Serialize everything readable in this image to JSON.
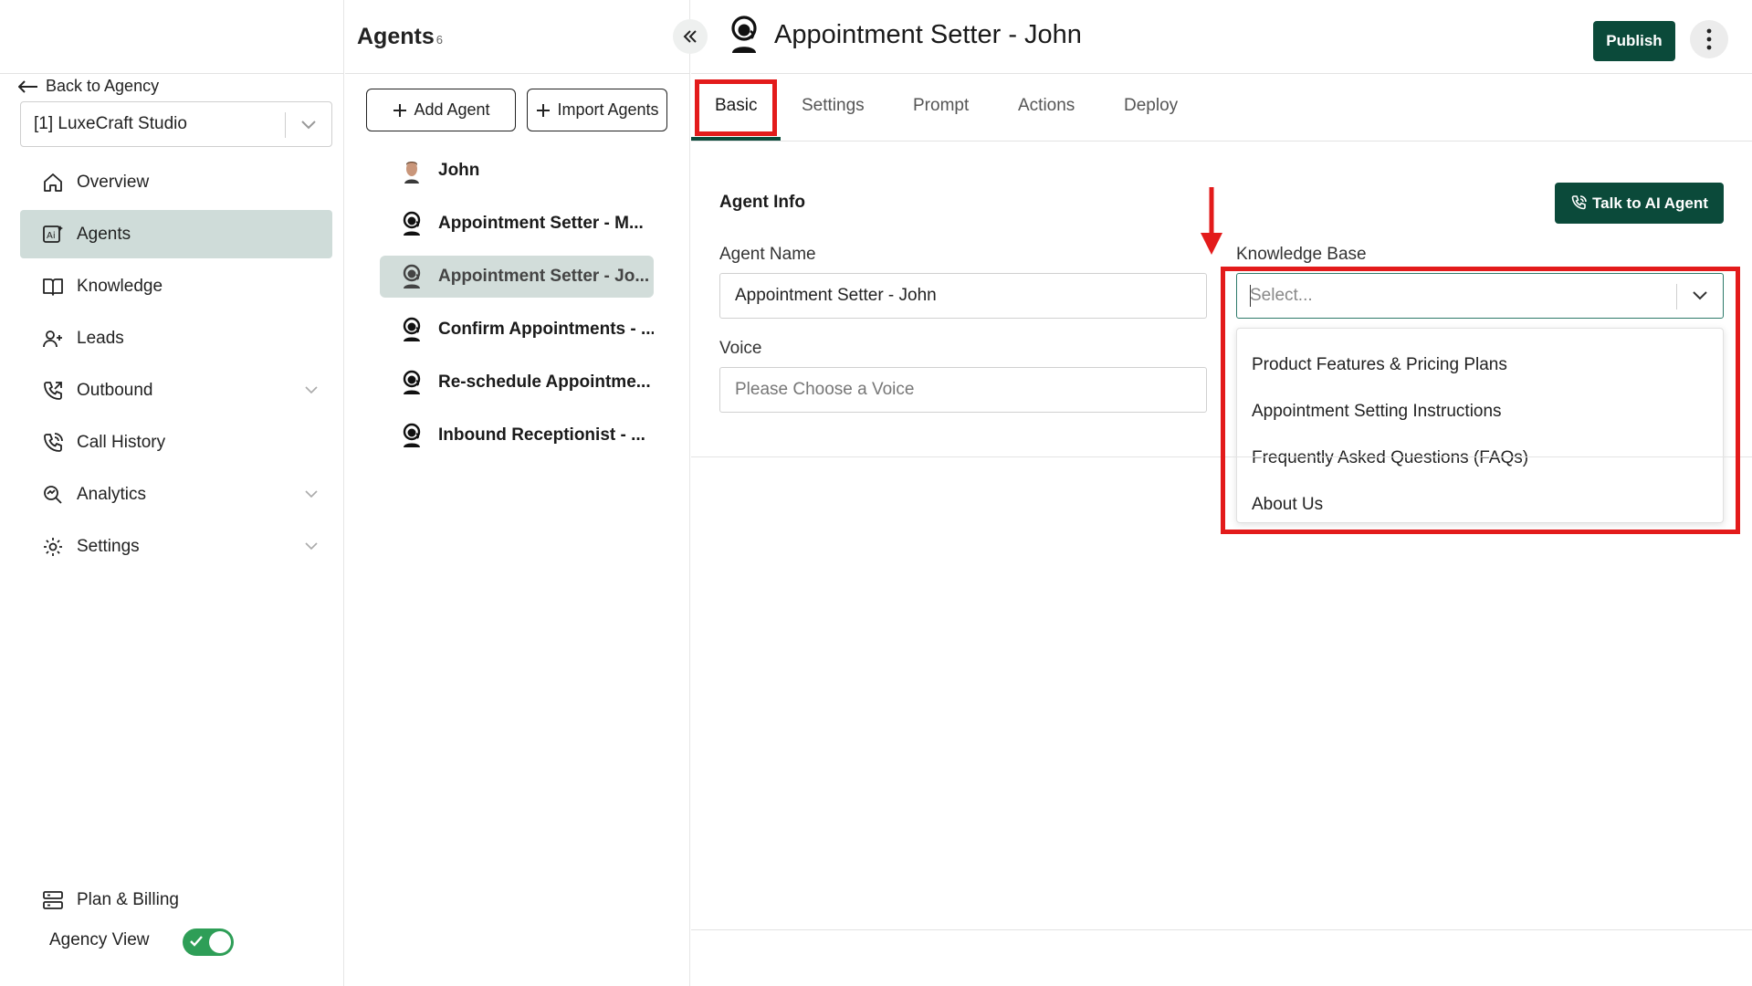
{
  "sidebar": {
    "back_label": "Back to Agency",
    "agency_select": "[1] LuxeCraft Studio",
    "items": [
      {
        "label": "Overview",
        "icon": "home-icon"
      },
      {
        "label": "Agents",
        "icon": "ai-agent-icon",
        "active": true
      },
      {
        "label": "Knowledge",
        "icon": "book-icon"
      },
      {
        "label": "Leads",
        "icon": "user-plus-icon"
      },
      {
        "label": "Outbound",
        "icon": "phone-outgoing-icon",
        "expandable": true
      },
      {
        "label": "Call History",
        "icon": "phone-history-icon"
      },
      {
        "label": "Analytics",
        "icon": "analytics-icon",
        "expandable": true
      },
      {
        "label": "Settings",
        "icon": "gear-icon",
        "expandable": true
      }
    ],
    "billing_label": "Plan & Billing",
    "agency_view_label": "Agency View",
    "agency_view_on": true
  },
  "agents": {
    "title": "Agents",
    "count": "6",
    "add_label": "Add Agent",
    "import_label": "Import Agents",
    "list": [
      {
        "name": "John",
        "icon": "avatar-photo"
      },
      {
        "name": "Appointment Setter - M...",
        "icon": "agent-headset-icon"
      },
      {
        "name": "Appointment Setter - Jo...",
        "icon": "agent-headset-icon",
        "active": true
      },
      {
        "name": "Confirm Appointments - ...",
        "icon": "agent-headset-icon"
      },
      {
        "name": "Re-schedule Appointme...",
        "icon": "agent-headset-icon"
      },
      {
        "name": "Inbound Receptionist - ...",
        "icon": "agent-headset-icon"
      }
    ]
  },
  "header": {
    "title": "Appointment Setter - John",
    "publish_label": "Publish"
  },
  "tabs": [
    "Basic",
    "Settings",
    "Prompt",
    "Actions",
    "Deploy"
  ],
  "active_tab": "Basic",
  "form": {
    "section_title": "Agent Info",
    "talk_label": "Talk to AI Agent",
    "agent_name_label": "Agent Name",
    "agent_name_value": "Appointment Setter - John",
    "voice_label": "Voice",
    "voice_placeholder": "Please Choose a Voice",
    "kb_label": "Knowledge Base",
    "kb_placeholder": "Select...",
    "kb_options": [
      "Product Features & Pricing Plans",
      "Appointment Setting Instructions",
      "Frequently Asked Questions (FAQs)",
      "About Us"
    ]
  },
  "colors": {
    "primary": "#0b4a3a",
    "active_bg": "#cfdcd9",
    "highlight": "#e31b1b",
    "toggle_on": "#2e9e57"
  }
}
